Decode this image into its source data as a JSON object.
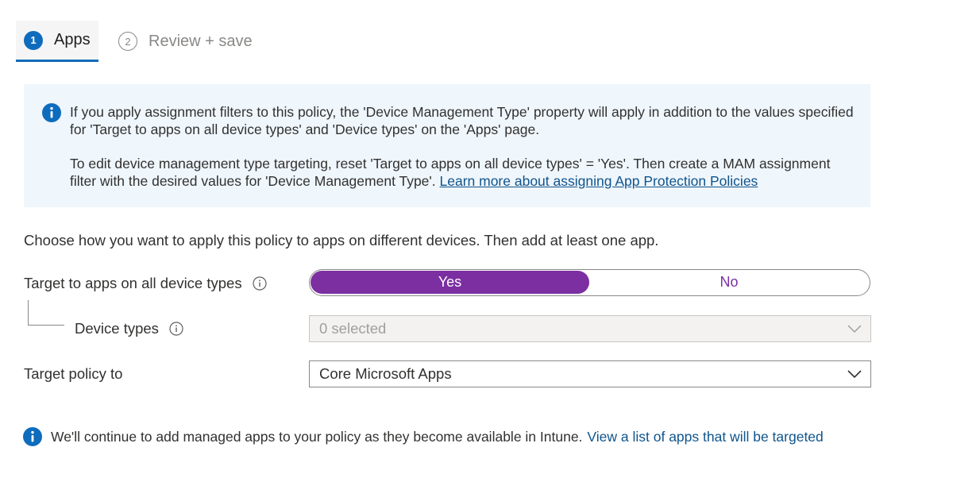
{
  "wizard": {
    "steps": [
      {
        "number": "1",
        "label": "Apps"
      },
      {
        "number": "2",
        "label": "Review + save"
      }
    ]
  },
  "banner": {
    "paragraph1": "If you apply assignment filters to this policy, the 'Device Management Type' property will apply in addition to the values specified for 'Target to apps on all device types' and 'Device types' on the 'Apps' page.",
    "paragraph2": "To edit device management type targeting, reset 'Target to apps on all device types' = 'Yes'. Then create a MAM assignment filter with the desired values for 'Device Management Type'.",
    "link": "Learn more about assigning App Protection Policies",
    "icon": "info-icon"
  },
  "intro": "Choose how you want to apply this policy to apps on different devices. Then add at least one app.",
  "form": {
    "target_all_label": "Target to apps on all device types",
    "toggle": {
      "yes": "Yes",
      "no": "No",
      "selected": "Yes"
    },
    "device_types_label": "Device types",
    "device_types_value": "0 selected",
    "target_policy_label": "Target policy to",
    "target_policy_value": "Core Microsoft Apps"
  },
  "note": {
    "text": "We'll continue to add managed apps to your policy as they become available in Intune.",
    "link": "View a list of apps that will be targeted"
  },
  "colors": {
    "accent": "#0f6cbd",
    "toggle_selected": "#7b2fa1",
    "banner_bg": "#eff6fc",
    "link": "#0f548c"
  }
}
